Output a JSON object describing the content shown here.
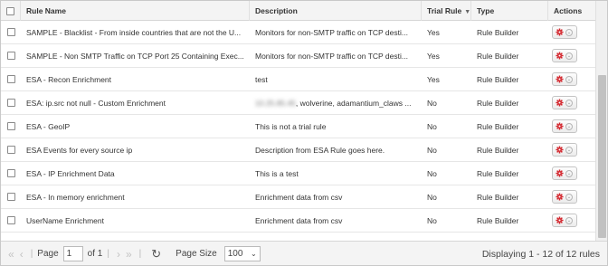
{
  "header": {
    "columns": [
      "Rule Name",
      "Description",
      "Trial Rule",
      "Type",
      "Actions"
    ]
  },
  "rows": [
    {
      "name": "SAMPLE - Blacklist - From inside countries that are not the U...",
      "desc": "Monitors for non-SMTP traffic on TCP desti...",
      "trial": "Yes",
      "type": "Rule Builder"
    },
    {
      "name": "SAMPLE - Non SMTP Traffic on TCP Port 25 Containing Exec...",
      "desc": "Monitors for non-SMTP traffic on TCP desti...",
      "trial": "Yes",
      "type": "Rule Builder"
    },
    {
      "name": "ESA - Recon Enrichment",
      "desc": "test",
      "trial": "Yes",
      "type": "Rule Builder"
    },
    {
      "name": "ESA: ip.src not null - Custom Enrichment",
      "desc_blur": "10.25.85.45",
      "desc": ", wolverine, adamantium_claws ...",
      "trial": "No",
      "type": "Rule Builder"
    },
    {
      "name": "ESA - GeoIP",
      "desc": "This is not a trial rule",
      "trial": "No",
      "type": "Rule Builder"
    },
    {
      "name": "ESA Events for every source ip",
      "desc": "Description from ESA Rule goes here.",
      "trial": "No",
      "type": "Rule Builder"
    },
    {
      "name": "ESA - IP Enrichment Data",
      "desc": "This is a test",
      "trial": "No",
      "type": "Rule Builder"
    },
    {
      "name": "ESA - In memory enrichment",
      "desc": "Enrichment data from csv",
      "trial": "No",
      "type": "Rule Builder"
    },
    {
      "name": "UserName Enrichment",
      "desc": "Enrichment data from csv",
      "trial": "No",
      "type": "Rule Builder"
    }
  ],
  "pager": {
    "page_label": "Page",
    "page_value": "1",
    "of_label": "of 1",
    "page_size_label": "Page Size",
    "page_size_value": "100",
    "display_text": "Displaying 1 - 12 of 12 rules"
  },
  "icons": {
    "gear": "gear-icon",
    "dropdown": "chevron-down-icon",
    "refresh": "refresh-icon"
  },
  "colors": {
    "gear": "#d3242b",
    "header_bg": "#f4f4f4"
  }
}
